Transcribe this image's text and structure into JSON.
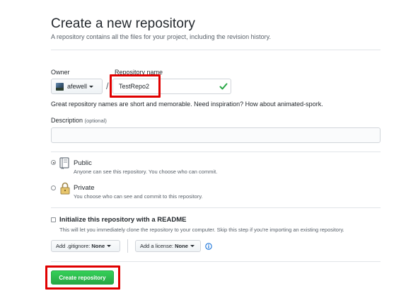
{
  "header": {
    "title": "Create a new repository",
    "subtitle": "A repository contains all the files for your project, including the revision history."
  },
  "owner": {
    "label": "Owner",
    "value": "afewell"
  },
  "repository": {
    "label": "Repository name",
    "separator": "/",
    "value": "TestRepo2",
    "hint": "Great repository names are short and memorable. Need inspiration? How about animated-spork."
  },
  "description": {
    "label": "Description",
    "optional": "(optional)",
    "value": ""
  },
  "visibility": {
    "public": {
      "title": "Public",
      "desc": "Anyone can see this repository. You choose who can commit.",
      "selected": true
    },
    "private": {
      "title": "Private",
      "desc": "You choose who can see and commit to this repository.",
      "selected": false
    }
  },
  "readme": {
    "title": "Initialize this repository with a README",
    "desc": "This will let you immediately clone the repository to your computer. Skip this step if you're importing an existing repository.",
    "checked": false
  },
  "gitignore": {
    "prefix": "Add .gitignore:",
    "value": "None"
  },
  "license": {
    "prefix": "Add a license:",
    "value": "None"
  },
  "submit": {
    "label": "Create repository"
  },
  "colors": {
    "primary_button": "#28a745",
    "valid_check": "#28a745",
    "annotation": "#e00000",
    "info_icon": "#0366d6"
  }
}
